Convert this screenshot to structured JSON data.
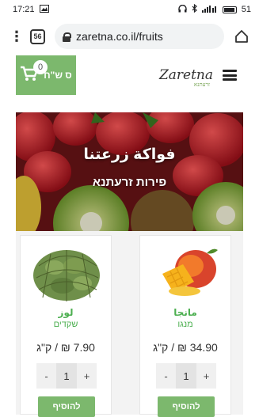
{
  "status_bar": {
    "time": "17:21",
    "right": "51"
  },
  "browser": {
    "tab_count": "56",
    "url": "zaretna.co.il/fruits"
  },
  "header": {
    "cart_count": "0",
    "cart_total": "ס ש\"ח",
    "logo_text": "Zaretna",
    "logo_sub": "זרעתנא",
    "accent_color": "#7cb86d"
  },
  "hero": {
    "title": "فواكة زرعتنا",
    "subtitle": "פירות זרעתנא"
  },
  "products": [
    {
      "name": "لوز",
      "sub": "שקדים",
      "price": "7.90 ₪ / ק\"ג",
      "qty": "1",
      "minus": "-",
      "plus": "+",
      "add_label": "להוסיף"
    },
    {
      "name": "مانجا",
      "sub": "מנגו",
      "price": "34.90 ₪ / ק\"ג",
      "qty": "1",
      "minus": "-",
      "plus": "+",
      "add_label": "להוסיף"
    }
  ]
}
